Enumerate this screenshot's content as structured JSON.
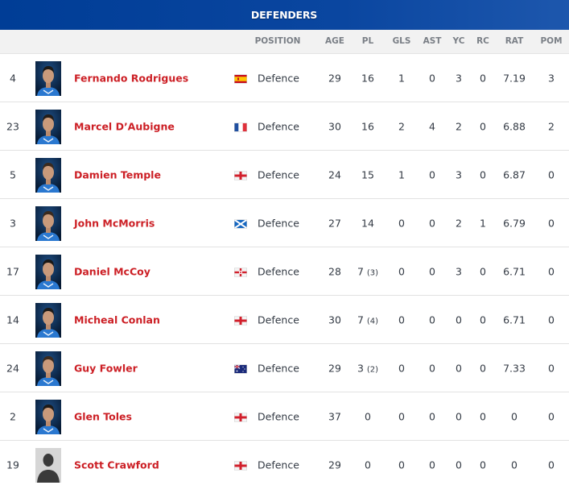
{
  "header": {
    "title": "DEFENDERS"
  },
  "columns": {
    "position": "POSITION",
    "age": "AGE",
    "pl": "PL",
    "gls": "GLS",
    "ast": "AST",
    "yc": "YC",
    "rc": "RC",
    "rat": "RAT",
    "pom": "POM"
  },
  "colors": {
    "header_blue": "#003d96",
    "name_red": "#cc1f25"
  },
  "players": [
    {
      "number": "4",
      "name": "Fernando Rodrigues",
      "photo": "player-photo",
      "flag": "spain-flag",
      "position": "Defence",
      "age": "29",
      "pl": "16",
      "pl_sub": "",
      "gls": "1",
      "ast": "0",
      "yc": "3",
      "rc": "0",
      "rat": "7.19",
      "pom": "3"
    },
    {
      "number": "23",
      "name": "Marcel D’Aubigne",
      "photo": "player-photo",
      "flag": "france-flag",
      "position": "Defence",
      "age": "30",
      "pl": "16",
      "pl_sub": "",
      "gls": "2",
      "ast": "4",
      "yc": "2",
      "rc": "0",
      "rat": "6.88",
      "pom": "2"
    },
    {
      "number": "5",
      "name": "Damien Temple",
      "photo": "player-photo",
      "flag": "england-flag",
      "position": "Defence",
      "age": "24",
      "pl": "15",
      "pl_sub": "",
      "gls": "1",
      "ast": "0",
      "yc": "3",
      "rc": "0",
      "rat": "6.87",
      "pom": "0"
    },
    {
      "number": "3",
      "name": "John McMorris",
      "photo": "player-photo",
      "flag": "scotland-flag",
      "position": "Defence",
      "age": "27",
      "pl": "14",
      "pl_sub": "",
      "gls": "0",
      "ast": "0",
      "yc": "2",
      "rc": "1",
      "rat": "6.79",
      "pom": "0"
    },
    {
      "number": "17",
      "name": "Daniel McCoy",
      "photo": "player-photo",
      "flag": "northern-ireland-flag",
      "position": "Defence",
      "age": "28",
      "pl": "7",
      "pl_sub": "(3)",
      "gls": "0",
      "ast": "0",
      "yc": "3",
      "rc": "0",
      "rat": "6.71",
      "pom": "0"
    },
    {
      "number": "14",
      "name": "Micheal Conlan",
      "photo": "player-photo",
      "flag": "england-flag",
      "position": "Defence",
      "age": "30",
      "pl": "7",
      "pl_sub": "(4)",
      "gls": "0",
      "ast": "0",
      "yc": "0",
      "rc": "0",
      "rat": "6.71",
      "pom": "0"
    },
    {
      "number": "24",
      "name": "Guy Fowler",
      "photo": "player-photo",
      "flag": "australia-flag",
      "position": "Defence",
      "age": "29",
      "pl": "3",
      "pl_sub": "(2)",
      "gls": "0",
      "ast": "0",
      "yc": "0",
      "rc": "0",
      "rat": "7.33",
      "pom": "0"
    },
    {
      "number": "2",
      "name": "Glen Toles",
      "photo": "player-photo",
      "flag": "england-flag",
      "position": "Defence",
      "age": "37",
      "pl": "0",
      "pl_sub": "",
      "gls": "0",
      "ast": "0",
      "yc": "0",
      "rc": "0",
      "rat": "0",
      "pom": "0"
    },
    {
      "number": "19",
      "name": "Scott Crawford",
      "photo": "placeholder-silhouette",
      "flag": "england-flag",
      "position": "Defence",
      "age": "29",
      "pl": "0",
      "pl_sub": "",
      "gls": "0",
      "ast": "0",
      "yc": "0",
      "rc": "0",
      "rat": "0",
      "pom": "0"
    }
  ]
}
